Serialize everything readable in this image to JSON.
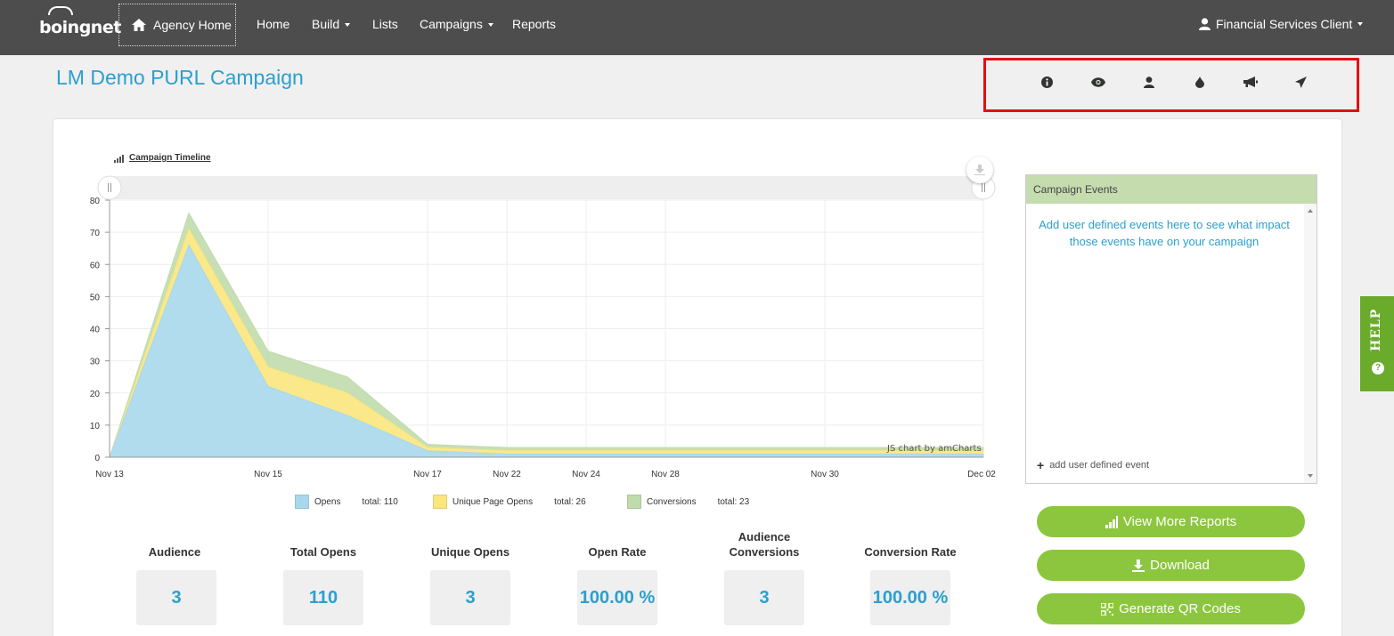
{
  "navbar": {
    "logo_text": "boingnet",
    "agency_home_label": "Agency Home",
    "links": [
      {
        "label": "Home",
        "dropdown": false
      },
      {
        "label": "Build",
        "dropdown": true
      },
      {
        "label": "Lists",
        "dropdown": false
      },
      {
        "label": "Campaigns",
        "dropdown": true
      },
      {
        "label": "Reports",
        "dropdown": false
      }
    ],
    "user_label": "Financial Services Client"
  },
  "page": {
    "title": "LM Demo PURL Campaign"
  },
  "toolbar": {
    "buttons": [
      {
        "icon": "info-icon",
        "color": "#f9dcd7"
      },
      {
        "icon": "eye-icon",
        "color": "#d7ead4"
      },
      {
        "icon": "user-icon",
        "color": "#fbe2c6"
      },
      {
        "icon": "drop-icon",
        "color": "#d8d3ea"
      },
      {
        "icon": "megaphone-icon",
        "color": "#c8d8f3"
      },
      {
        "icon": "paper-plane-icon",
        "color": "#f5f3c9"
      }
    ]
  },
  "chart_data": {
    "type": "area",
    "stacked": true,
    "title": "Campaign Timeline",
    "x": [
      "Nov 13",
      "Nov 14",
      "Nov 15",
      "Nov 16",
      "Nov 17",
      "Nov 22",
      "Nov 24",
      "Nov 28",
      "Nov 30",
      "Dec 02"
    ],
    "x_tick_labels": [
      "Nov 13",
      "Nov 15",
      "Nov 17",
      "Nov 22",
      "Nov 24",
      "Nov 28",
      "Nov 30",
      "Dec 02"
    ],
    "ylim": [
      0,
      80
    ],
    "y_ticks": [
      0,
      10,
      20,
      30,
      40,
      50,
      60,
      70,
      80
    ],
    "series": [
      {
        "name": "Opens",
        "total_label": "total: 110",
        "color": "#a9d8ec",
        "values": [
          0,
          66,
          22,
          13,
          2,
          1,
          1,
          1,
          1,
          1
        ]
      },
      {
        "name": "Unique Page Opens",
        "total_label": "total: 26",
        "color": "#fbe57d",
        "values": [
          0,
          5,
          6,
          7,
          1,
          1,
          1,
          1,
          1,
          1
        ]
      },
      {
        "name": "Conversions",
        "total_label": "total: 23",
        "color": "#c0dbac",
        "values": [
          0,
          5,
          5,
          5,
          1,
          1,
          1,
          1,
          1,
          1
        ]
      }
    ],
    "grid": true,
    "legend_position": "bottom",
    "credit": "JS chart by amCharts"
  },
  "stats": [
    {
      "label": "Audience",
      "value": "3"
    },
    {
      "label": "Total Opens",
      "value": "110"
    },
    {
      "label": "Unique Opens",
      "value": "3"
    },
    {
      "label": "Open Rate",
      "value": "100.00 %"
    },
    {
      "label": "Audience Conversions",
      "value": "3"
    },
    {
      "label": "Conversion Rate",
      "value": "100.00 %"
    }
  ],
  "events_panel": {
    "title": "Campaign Events",
    "message": "Add user defined events here to see what impact those events have on your campaign",
    "add_label": "add user defined event"
  },
  "actions": [
    {
      "label": "View More Reports",
      "icon": "bar-chart-icon"
    },
    {
      "label": "Download",
      "icon": "download-icon"
    },
    {
      "label": "Generate QR Codes",
      "icon": "qr-code-icon"
    }
  ],
  "help_tab": {
    "label": "HELP"
  }
}
